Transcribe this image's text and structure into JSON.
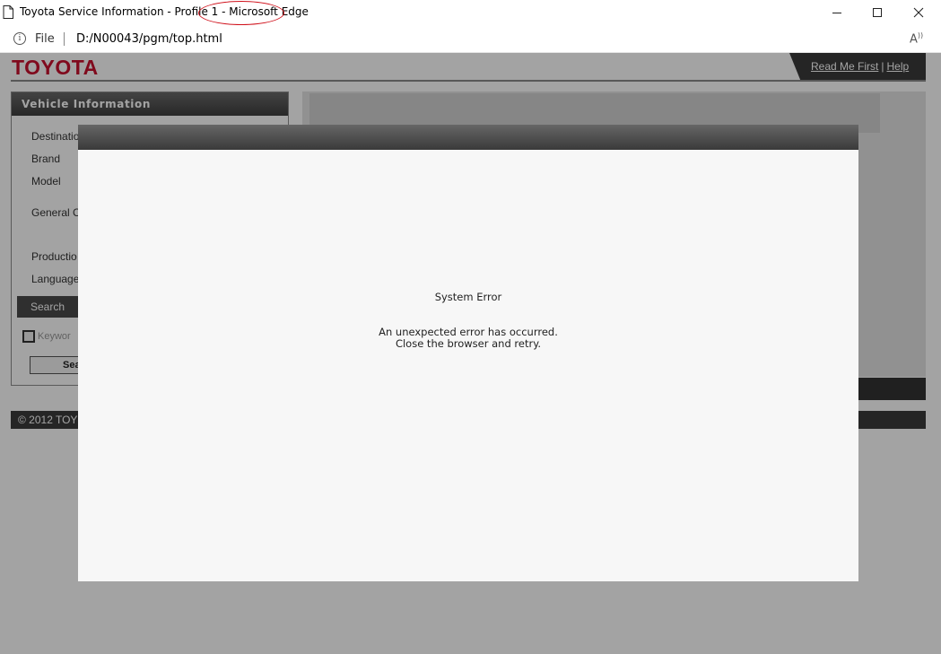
{
  "window": {
    "title_main": "Toyota Service Information - Profile 1 - ",
    "title_highlight": "Microsoft Edge"
  },
  "address_bar": {
    "scheme_label": "File",
    "url": "D:/N00043/pgm/top.html"
  },
  "header": {
    "logo": "TOYOTA",
    "read_me_first": "Read Me First",
    "separator": "|",
    "help": "Help"
  },
  "vehicle_panel": {
    "title": "Vehicle Information",
    "labels": [
      "Destinatio",
      "Brand",
      "Model",
      "General C",
      "Productio",
      "Language"
    ],
    "search_tab": "Search",
    "keyword_placeholder": "Keywor",
    "search_button": "Sea"
  },
  "footer": {
    "copyright": "© 2012 TOY"
  },
  "dialog": {
    "title": "System Error",
    "message_line1": "An unexpected error has occurred.",
    "message_line2": "Close the browser and retry."
  },
  "colors": {
    "brand_red": "#c8102e",
    "highlight_ring": "#d0111b"
  }
}
